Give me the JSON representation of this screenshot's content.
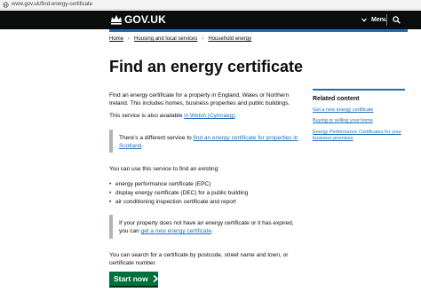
{
  "browser": {
    "url": "www.gov.uk/find-energy-certificate"
  },
  "header": {
    "logo_text": "GOV.UK",
    "menu_label": "Menu"
  },
  "breadcrumb": [
    "Home",
    "Housing and local services",
    "Household energy"
  ],
  "page": {
    "title": "Find an energy certificate",
    "intro": "Find an energy certificate for a property in England, Wales or Northern Ireland. This includes homes, business properties and public buildings.",
    "welsh_prefix": "This service is also available ",
    "welsh_link": "in Welsh (Cymraeg)",
    "welsh_suffix": ".",
    "scotland_prefix": "There’s a different service to ",
    "scotland_link": "find an energy certificate for properties in Scotland",
    "scotland_suffix": ".",
    "use_intro": "You can use this service to find an existing:",
    "list_items": [
      "energy performance certificate (EPC)",
      "display energy certificate (DEC) for a public building",
      "air conditioning inspection certificate and report"
    ],
    "expired_prefix": "If your property does not have an energy certificate or it has expired, you can ",
    "expired_link": "get a new energy certificate",
    "expired_suffix": ".",
    "search_text": "You can search for a certificate by postcode, street name and town, or certificate number.",
    "start_label": "Start now"
  },
  "related": {
    "title": "Related content",
    "links": [
      "Get a new energy certificate",
      "Buying or selling your home",
      "Energy Performance Certificates for your business premises"
    ]
  },
  "colors": {
    "header_bg": "#0b0c0c",
    "link": "#1d70b8",
    "start_button": "#00703c",
    "inset_border": "#b1b4b6"
  },
  "icons": [
    "globe-icon",
    "crown-icon",
    "chevron-down-icon",
    "search-icon",
    "arrow-right-icon"
  ]
}
